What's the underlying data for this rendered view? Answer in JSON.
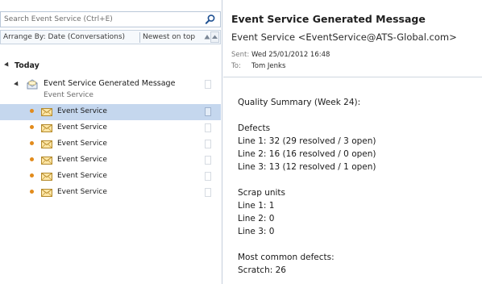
{
  "search": {
    "placeholder": "Search Event Service (Ctrl+E)"
  },
  "arrange": {
    "label": "Arrange By: Date (Conversations)",
    "order": "Newest on top"
  },
  "group": {
    "label": "Today"
  },
  "conversation": {
    "subject": "Event Service Generated Message",
    "sender": "Event Service"
  },
  "messages": [
    {
      "sender": "Event Service",
      "selected": true
    },
    {
      "sender": "Event Service",
      "selected": false
    },
    {
      "sender": "Event Service",
      "selected": false
    },
    {
      "sender": "Event Service",
      "selected": false
    },
    {
      "sender": "Event Service",
      "selected": false
    },
    {
      "sender": "Event Service",
      "selected": false
    }
  ],
  "reading": {
    "subject": "Event Service Generated Message",
    "from": "Event Service <EventService@ATS-Global.com>",
    "sent_label": "Sent:",
    "sent_value": "Wed 25/01/2012 16:48",
    "to_label": "To:",
    "to_value": "Tom Jenks",
    "body": [
      "Quality Summary (Week 24):",
      "",
      "Defects",
      "Line 1: 32 (29 resolved / 3 open)",
      "Line 2: 16 (16 resolved / 0 open)",
      "Line 3: 13 (12 resolved / 1 open)",
      "",
      "Scrap units",
      "Line 1: 1",
      "Line 2: 0",
      "Line 3: 0",
      "",
      "Most common defects:",
      "Scratch: 26"
    ]
  },
  "colors": {
    "selected_row": "#c5d7ee",
    "unread_dot": "#e28b1c",
    "border": "#c5cfdc"
  }
}
